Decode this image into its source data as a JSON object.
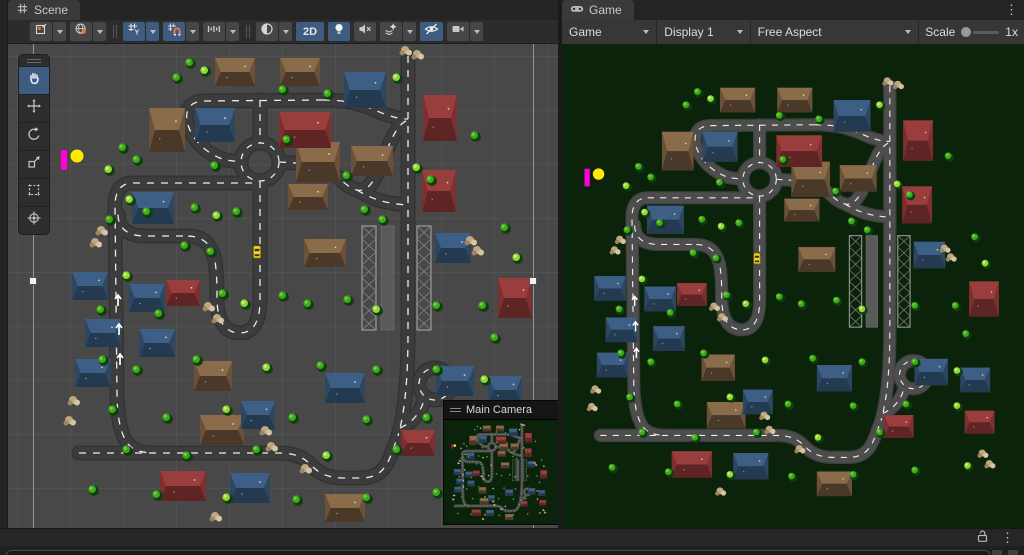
{
  "scene_panel": {
    "tab": {
      "label": "Scene",
      "icon": "grid-icon"
    },
    "toolbar": {
      "buttons": [
        {
          "name": "tool-settings",
          "icon": "pivot-icon",
          "dropdown": true,
          "active": false
        },
        {
          "name": "handle-rotation",
          "icon": "globe-icon",
          "dropdown": true,
          "active": false
        },
        {
          "name": "grid-visibility",
          "icon": "grid-y-icon",
          "dropdown": true,
          "active": true
        },
        {
          "name": "grid-snapping",
          "icon": "grid-magnet-icon",
          "dropdown": true,
          "active": true
        },
        {
          "name": "snap-increment",
          "icon": "ruler-icon",
          "dropdown": true,
          "active": false
        },
        {
          "name": "draw-mode",
          "icon": "shaded-sphere-icon",
          "dropdown": true,
          "active": false
        },
        {
          "name": "view-2d-toggle",
          "label": "2D",
          "dropdown": false,
          "active": true
        },
        {
          "name": "scene-lighting-toggle",
          "icon": "lightbulb-icon",
          "dropdown": false,
          "active": true
        },
        {
          "name": "audio-mute-toggle",
          "icon": "speaker-muted-icon",
          "dropdown": false,
          "active": false
        },
        {
          "name": "effects-menu",
          "icon": "effects-star-icon",
          "dropdown": true,
          "active": false
        },
        {
          "name": "hidden-objects-toggle",
          "icon": "eye-slash-icon",
          "dropdown": false,
          "active": true
        },
        {
          "name": "camera-settings",
          "icon": "scene-camera-icon",
          "dropdown": true,
          "active": false
        }
      ]
    },
    "tool_palette": {
      "tools": [
        "hand-tool",
        "move-tool",
        "rotate-tool",
        "scale-tool",
        "rect-tool",
        "transform-tool"
      ],
      "active_tool": "hand-tool"
    },
    "camera_preview": {
      "title": "Main Camera"
    }
  },
  "game_panel": {
    "tab": {
      "label": "Game",
      "icon": "gamepad-icon"
    },
    "toolbar": {
      "mode_dropdown": "Game",
      "display_dropdown": "Display 1",
      "aspect_dropdown": "Free Aspect",
      "scale_label": "Scale",
      "scale_value": "1x"
    }
  },
  "bottom_bar": {
    "icons": [
      "unlock-icon",
      "kebab-icon"
    ]
  },
  "colors": {
    "scene_background": "#484848",
    "game_background": "#0b230b",
    "road_scene": "#3c3c3c",
    "road_game": "#4d4d4d",
    "selection_blue": "#3d5c80",
    "gizmo_yellow": "#ffe900",
    "gizmo_magenta": "#ff00dd",
    "car_yellow": "#f7d713"
  }
}
